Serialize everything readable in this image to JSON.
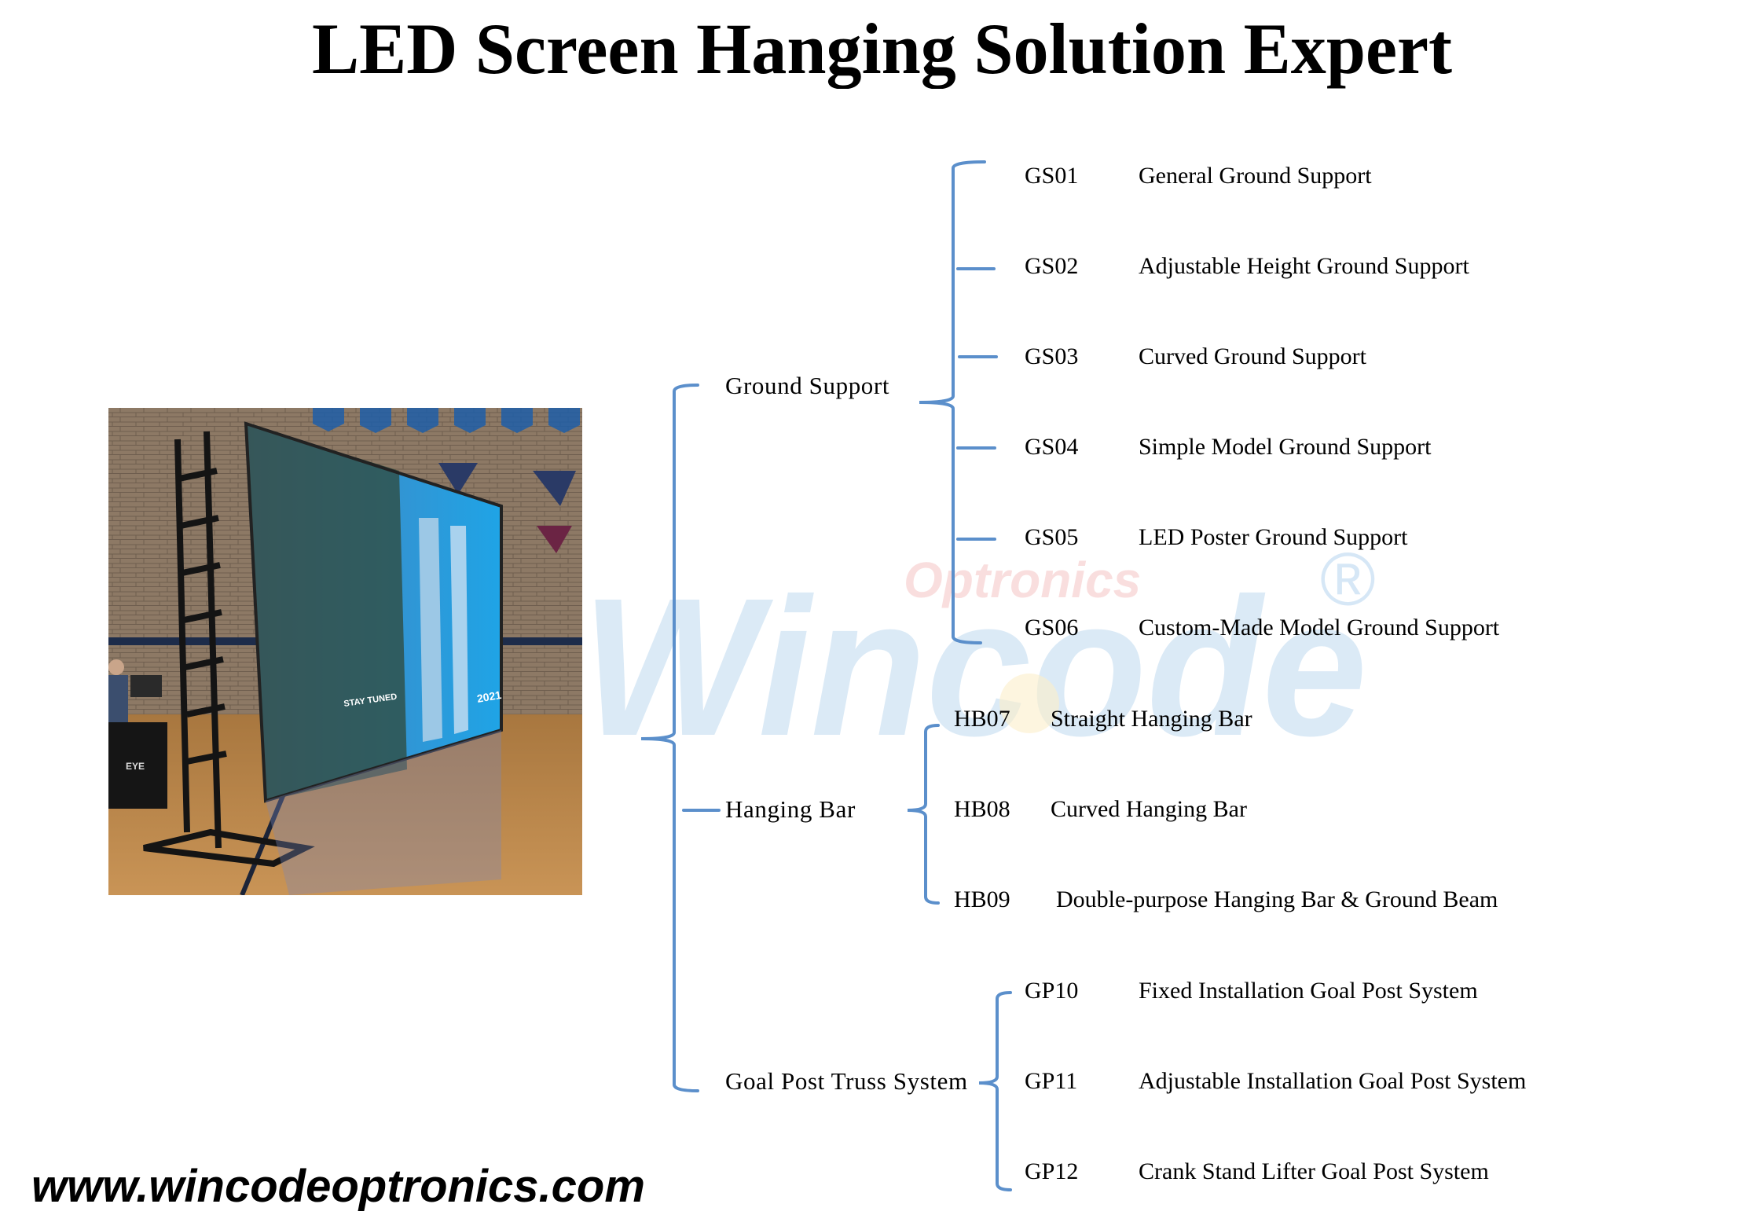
{
  "title": "LED Screen Hanging Solution Expert",
  "photo": {
    "description": "LED screen on ground support stand in gymnasium",
    "screen_text": "STAY TUNED",
    "screen_badge": "2021",
    "equipment_label": "EYE"
  },
  "watermark": {
    "brand": "Wincode",
    "subtitle": "Optronics",
    "registered_mark": "®",
    "colors": {
      "brand": "#cfe3f4",
      "subtitle": "#f8d6d6",
      "accent": "#fbefc9"
    }
  },
  "diagram": {
    "line_color": "#5b8fcb",
    "categories": [
      {
        "label": "Ground Support",
        "items": [
          {
            "code": "GS01",
            "name": "General Ground Support"
          },
          {
            "code": "GS02",
            "name": "Adjustable Height Ground Support"
          },
          {
            "code": "GS03",
            "name": "Curved Ground Support"
          },
          {
            "code": "GS04",
            "name": "Simple Model Ground Support"
          },
          {
            "code": "GS05",
            "name": "LED Poster Ground Support"
          },
          {
            "code": "GS06",
            "name": "Custom-Made Model Ground Support"
          }
        ]
      },
      {
        "label": "Hanging Bar",
        "items": [
          {
            "code": "HB07",
            "name": "Straight Hanging Bar"
          },
          {
            "code": "HB08",
            "name": "Curved Hanging Bar"
          },
          {
            "code": "HB09",
            "name": "Double-purpose Hanging Bar & Ground Beam"
          }
        ]
      },
      {
        "label": "Goal Post Truss System",
        "items": [
          {
            "code": "GP10",
            "name": "Fixed Installation Goal Post System"
          },
          {
            "code": "GP11",
            "name": "Adjustable Installation Goal Post System"
          },
          {
            "code": "GP12",
            "name": "Crank Stand Lifter Goal Post System"
          }
        ]
      }
    ]
  },
  "footer": {
    "url": "www.wincodeoptronics.com"
  }
}
